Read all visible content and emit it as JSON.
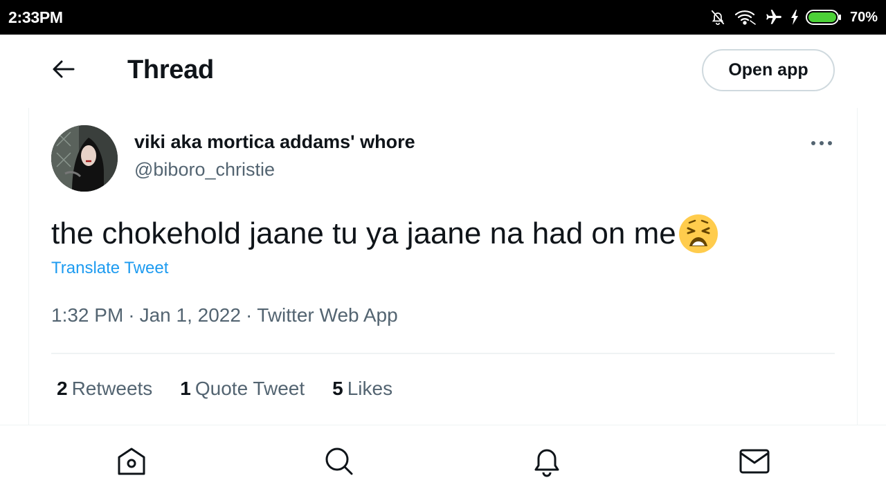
{
  "status_bar": {
    "time": "2:33PM",
    "battery_percent": "70%",
    "icons": [
      "notifications-off-icon",
      "wifi-icon",
      "airplane-icon",
      "charging-icon",
      "battery-icon"
    ]
  },
  "header": {
    "back_icon": "arrow-left-icon",
    "title": "Thread",
    "open_app_label": "Open app"
  },
  "tweet": {
    "display_name": "viki aka mortica addams' whore",
    "handle": "@biboro_christie",
    "text": "the chokehold jaane tu ya jaane na had on me",
    "emoji": "weary-face-emoji",
    "translate_label": "Translate Tweet",
    "time": "1:32 PM",
    "date": "Jan 1, 2022",
    "source": "Twitter Web App",
    "separator": "·",
    "stats": {
      "retweets_count": "2",
      "retweets_label": "Retweets",
      "quotes_count": "1",
      "quotes_label": "Quote Tweet",
      "likes_count": "5",
      "likes_label": "Likes"
    }
  },
  "bottom_nav": {
    "items": [
      "home-icon",
      "search-icon",
      "notifications-icon",
      "messages-icon"
    ]
  },
  "colors": {
    "text_primary": "#0f1419",
    "text_secondary": "#536471",
    "link": "#1d9bf0",
    "border": "#cfd9de",
    "battery_fill": "#4cd137"
  }
}
